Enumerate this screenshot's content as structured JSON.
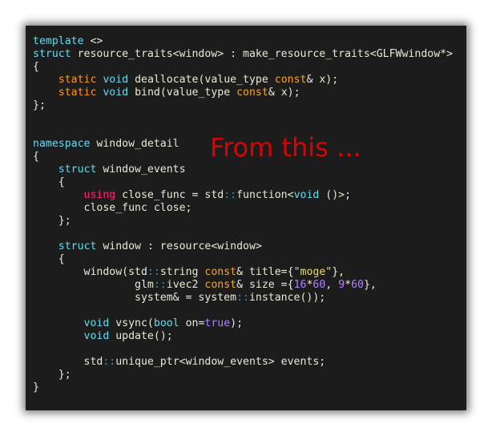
{
  "overlay_caption": "From this ...",
  "colors": {
    "background": "#1c1c1c",
    "default_text": "#e8e8d8",
    "keyword": "#66d9ef",
    "storage_specifier": "#fd971f",
    "const_qualifier": "#f6a623",
    "using_keyword": "#f92672",
    "literal_bool_number": "#ae81ff",
    "string_literal": "#e6db74",
    "scope_operator": "#3a8fb7",
    "caption": "#e00000"
  },
  "code_lines": [
    [
      {
        "t": "template",
        "c": "kw"
      },
      {
        "t": " <>",
        "c": "plain"
      }
    ],
    [
      {
        "t": "struct",
        "c": "kw"
      },
      {
        "t": " resource_traits<window> : make_resource_traits<GLFWwindow*>",
        "c": "plain"
      }
    ],
    [
      {
        "t": "{",
        "c": "plain"
      }
    ],
    [
      {
        "t": "    ",
        "c": "plain"
      },
      {
        "t": "static",
        "c": "storage"
      },
      {
        "t": " ",
        "c": "plain"
      },
      {
        "t": "void",
        "c": "type"
      },
      {
        "t": " deallocate(value_type ",
        "c": "plain"
      },
      {
        "t": "const",
        "c": "qual"
      },
      {
        "t": "& x);",
        "c": "plain"
      }
    ],
    [
      {
        "t": "    ",
        "c": "plain"
      },
      {
        "t": "static",
        "c": "storage"
      },
      {
        "t": " ",
        "c": "plain"
      },
      {
        "t": "void",
        "c": "type"
      },
      {
        "t": " bind(value_type ",
        "c": "plain"
      },
      {
        "t": "const",
        "c": "qual"
      },
      {
        "t": "& x);",
        "c": "plain"
      }
    ],
    [
      {
        "t": "};",
        "c": "plain"
      }
    ],
    [],
    [],
    [
      {
        "t": "namespace",
        "c": "kw"
      },
      {
        "t": " window_detail",
        "c": "plain"
      }
    ],
    [
      {
        "t": "{",
        "c": "plain"
      }
    ],
    [
      {
        "t": "    ",
        "c": "plain"
      },
      {
        "t": "struct",
        "c": "kw"
      },
      {
        "t": " window_events",
        "c": "plain"
      }
    ],
    [
      {
        "t": "    {",
        "c": "plain"
      }
    ],
    [
      {
        "t": "        ",
        "c": "plain"
      },
      {
        "t": "using",
        "c": "using"
      },
      {
        "t": " close_func = std",
        "c": "plain"
      },
      {
        "t": "::",
        "c": "scope"
      },
      {
        "t": "function<",
        "c": "plain"
      },
      {
        "t": "void",
        "c": "type"
      },
      {
        "t": " ()>;",
        "c": "plain"
      }
    ],
    [
      {
        "t": "        close_func close;",
        "c": "plain"
      }
    ],
    [
      {
        "t": "    };",
        "c": "plain"
      }
    ],
    [],
    [
      {
        "t": "    ",
        "c": "plain"
      },
      {
        "t": "struct",
        "c": "kw"
      },
      {
        "t": " window : resource<window>",
        "c": "plain"
      }
    ],
    [
      {
        "t": "    {",
        "c": "plain"
      }
    ],
    [
      {
        "t": "        window(std",
        "c": "plain"
      },
      {
        "t": "::",
        "c": "scope"
      },
      {
        "t": "string ",
        "c": "plain"
      },
      {
        "t": "const",
        "c": "qual"
      },
      {
        "t": "& title={",
        "c": "plain"
      },
      {
        "t": "\"moge\"",
        "c": "str"
      },
      {
        "t": "},",
        "c": "plain"
      }
    ],
    [
      {
        "t": "                glm",
        "c": "plain"
      },
      {
        "t": "::",
        "c": "scope"
      },
      {
        "t": "ivec2 ",
        "c": "plain"
      },
      {
        "t": "const",
        "c": "qual"
      },
      {
        "t": "& size ={",
        "c": "plain"
      },
      {
        "t": "16",
        "c": "num"
      },
      {
        "t": "*",
        "c": "plain"
      },
      {
        "t": "60",
        "c": "num"
      },
      {
        "t": ", ",
        "c": "plain"
      },
      {
        "t": "9",
        "c": "num"
      },
      {
        "t": "*",
        "c": "plain"
      },
      {
        "t": "60",
        "c": "num"
      },
      {
        "t": "},",
        "c": "plain"
      }
    ],
    [
      {
        "t": "                system& = system",
        "c": "plain"
      },
      {
        "t": "::",
        "c": "scope"
      },
      {
        "t": "instance());",
        "c": "plain"
      }
    ],
    [],
    [
      {
        "t": "        ",
        "c": "plain"
      },
      {
        "t": "void",
        "c": "type"
      },
      {
        "t": " vsync(",
        "c": "plain"
      },
      {
        "t": "bool",
        "c": "type"
      },
      {
        "t": " on=",
        "c": "plain"
      },
      {
        "t": "true",
        "c": "bool"
      },
      {
        "t": ");",
        "c": "plain"
      }
    ],
    [
      {
        "t": "        ",
        "c": "plain"
      },
      {
        "t": "void",
        "c": "type"
      },
      {
        "t": " update();",
        "c": "plain"
      }
    ],
    [],
    [
      {
        "t": "        std",
        "c": "plain"
      },
      {
        "t": "::",
        "c": "scope"
      },
      {
        "t": "unique_ptr<window_events> events;",
        "c": "plain"
      }
    ],
    [
      {
        "t": "    };",
        "c": "plain"
      }
    ],
    [
      {
        "t": "}",
        "c": "plain"
      }
    ]
  ]
}
